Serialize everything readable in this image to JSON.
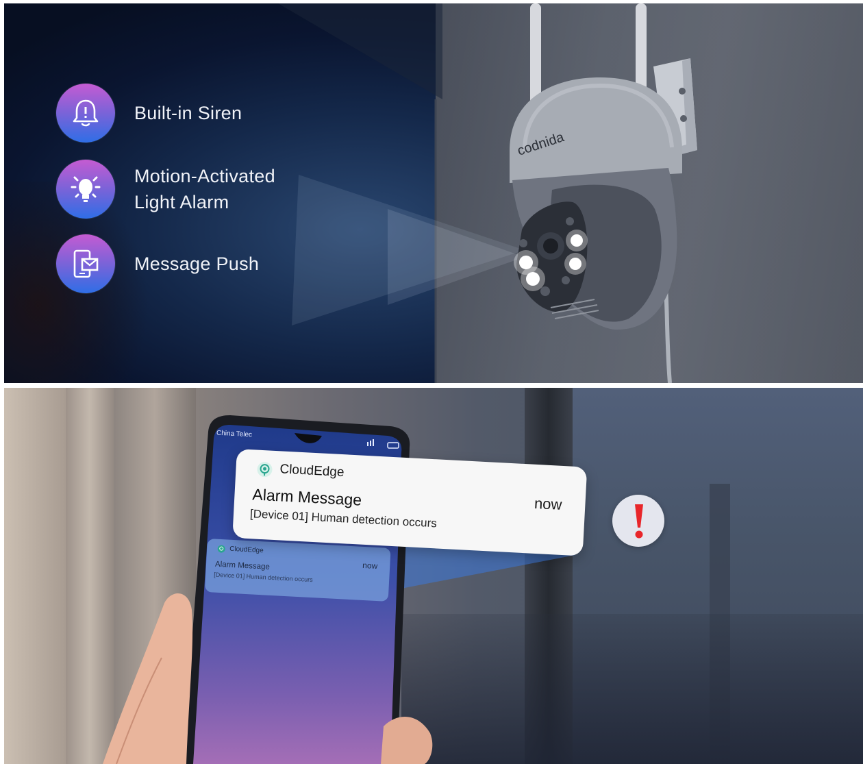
{
  "features": [
    {
      "label_line1": "Built-in Siren",
      "label_line2": "",
      "icon": "bell-alert-icon"
    },
    {
      "label_line1": "Motion-Activated",
      "label_line2": "Light Alarm",
      "icon": "light-bulb-icon"
    },
    {
      "label_line1": "Message Push",
      "label_line2": "",
      "icon": "phone-message-icon"
    }
  ],
  "camera": {
    "brand": "codnida"
  },
  "phone": {
    "carrier": "China Telec"
  },
  "notification_large": {
    "app_name": "CloudEdge",
    "time": "now",
    "title": "Alarm Message",
    "body": "[Device 01] Human detection occurs"
  },
  "notification_small": {
    "app_name": "CloudEdge",
    "time": "now",
    "title": "Alarm Message",
    "body": "[Device 01] Human detection occurs"
  },
  "alert": {
    "symbol": "!",
    "color": "#e8262a"
  },
  "colors": {
    "icon_gradient_top": "#c55bd2",
    "icon_gradient_bottom": "#2f6ee6",
    "night_sky": "#14284a"
  }
}
